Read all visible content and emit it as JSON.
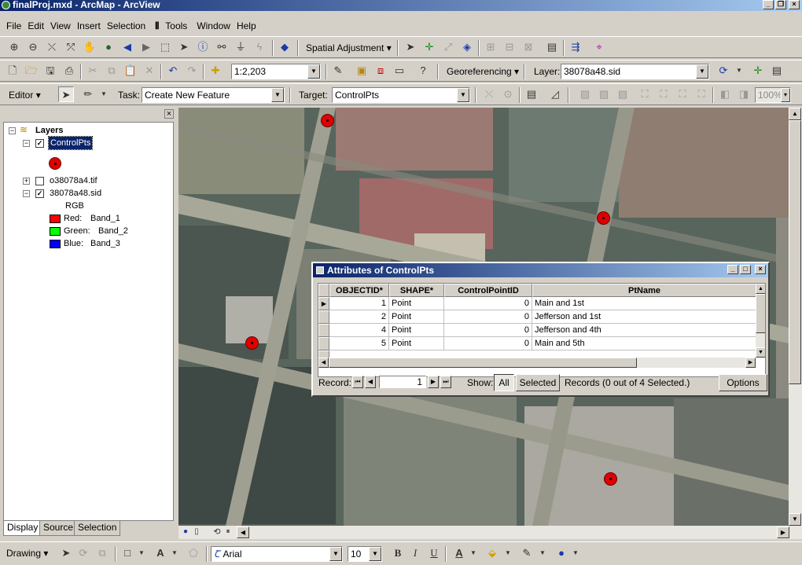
{
  "window": {
    "title": "finalProj.mxd - ArcMap - ArcView"
  },
  "menu": [
    "File",
    "Edit",
    "View",
    "Insert",
    "Selection",
    "Tools",
    "Window",
    "Help"
  ],
  "toolbar1": {
    "spatial_adjustment": "Spatial Adjustment"
  },
  "toolbar2": {
    "scale": "1:2,203",
    "georeferencing": "Georeferencing",
    "layer_label": "Layer:",
    "layer_value": "38078a48.sid"
  },
  "editor": {
    "editor_label": "Editor",
    "task_label": "Task:",
    "task_value": "Create New Feature",
    "target_label": "Target:",
    "target_value": "ControlPts",
    "zoom_value": "100%"
  },
  "toc": {
    "root": "Layers",
    "layers": [
      {
        "name": "ControlPts",
        "checked": true,
        "expanded": true
      },
      {
        "name": "o38078a4.tif",
        "checked": false,
        "expanded": false
      },
      {
        "name": "38078a48.sid",
        "checked": true,
        "expanded": true
      }
    ],
    "raster_type": "RGB",
    "bands": [
      {
        "label": "Red:",
        "band": "Band_1",
        "color": "#ff0000"
      },
      {
        "label": "Green:",
        "band": "Band_2",
        "color": "#00ff00"
      },
      {
        "label": "Blue:",
        "band": "Band_3",
        "color": "#0000ff"
      }
    ],
    "tabs": [
      "Display",
      "Source",
      "Selection"
    ]
  },
  "attributes": {
    "title": "Attributes of ControlPts",
    "columns": [
      "OBJECTID*",
      "SHAPE*",
      "ControlPointID",
      "PtName"
    ],
    "rows": [
      {
        "OBJECTID": "1",
        "SHAPE": "Point",
        "ControlPointID": "0",
        "PtName": "Main and 1st"
      },
      {
        "OBJECTID": "2",
        "SHAPE": "Point",
        "ControlPointID": "0",
        "PtName": "Jefferson and 1st"
      },
      {
        "OBJECTID": "4",
        "SHAPE": "Point",
        "ControlPointID": "0",
        "PtName": "Jefferson and 4th"
      },
      {
        "OBJECTID": "5",
        "SHAPE": "Point",
        "ControlPointID": "0",
        "PtName": "Main and 5th"
      }
    ],
    "record_label": "Record:",
    "record_value": "1",
    "show_label": "Show:",
    "show_all": "All",
    "show_selected": "Selected",
    "records_status": "Records  (0 out of 4 Selected.)",
    "options": "Options"
  },
  "drawing": {
    "label": "Drawing",
    "font": "Arial",
    "size": "10",
    "bold": "B",
    "italic": "I",
    "underline": "U"
  },
  "colors": {
    "control_point": "#e00000",
    "title_bar": "#0a246a",
    "face": "#d4d0c8"
  }
}
